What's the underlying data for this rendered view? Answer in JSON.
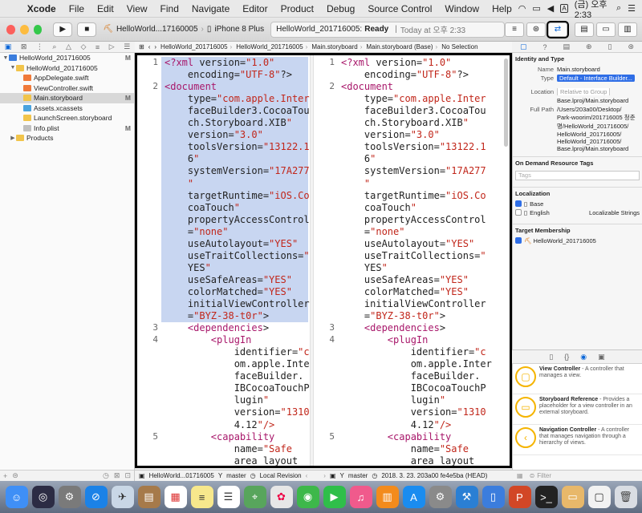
{
  "menubar": {
    "app": "Xcode",
    "items": [
      "File",
      "Edit",
      "View",
      "Find",
      "Navigate",
      "Editor",
      "Product",
      "Debug",
      "Source Control",
      "Window",
      "Help"
    ],
    "input_indicator": "A",
    "clock": "(금) 오후 2:33"
  },
  "toolbar": {
    "scheme_target": "HelloWorld...17160005",
    "device": "iPhone 8 Plus",
    "activity_project": "HelloWorld_201716005:",
    "activity_status": "Ready",
    "activity_time": "Today at 오후 2:33"
  },
  "navigator": {
    "items": [
      {
        "label": "HelloWorld_201716005",
        "indent": 0,
        "disc": "▼",
        "icon": "#3b7ddd",
        "status": "M"
      },
      {
        "label": "HelloWorld_201716005",
        "indent": 1,
        "disc": "▼",
        "icon": "#f1c44b",
        "status": ""
      },
      {
        "label": "AppDelegate.swift",
        "indent": 2,
        "disc": "",
        "icon": "#f07a3a",
        "status": ""
      },
      {
        "label": "ViewController.swift",
        "indent": 2,
        "disc": "",
        "icon": "#f07a3a",
        "status": ""
      },
      {
        "label": "Main.storyboard",
        "indent": 2,
        "disc": "",
        "icon": "#f1c44b",
        "status": "M",
        "selected": true
      },
      {
        "label": "Assets.xcassets",
        "indent": 2,
        "disc": "",
        "icon": "#4aa3df",
        "status": ""
      },
      {
        "label": "LaunchScreen.storyboard",
        "indent": 2,
        "disc": "",
        "icon": "#f1c44b",
        "status": ""
      },
      {
        "label": "Info.plist",
        "indent": 2,
        "disc": "",
        "icon": "#bfbfbf",
        "status": "M"
      },
      {
        "label": "Products",
        "indent": 1,
        "disc": "▶",
        "icon": "#f1c44b",
        "status": ""
      }
    ]
  },
  "jumpbar": {
    "crumbs": [
      "HelloWorld_201716005",
      "HelloWorld_201716005",
      "Main.storyboard",
      "Main.storyboard (Base)",
      "No Selection"
    ]
  },
  "editor": {
    "left_lines": [
      {
        "num": "1",
        "text": "<?xml version=\"1.0\"",
        "hl": true
      },
      {
        "num": "",
        "text": "    encoding=\"UTF-8\"?>",
        "hl": true
      },
      {
        "num": "2",
        "text": "<document",
        "hl": true
      },
      {
        "num": "",
        "text": "    type=\"com.apple.Inter",
        "hl": true
      },
      {
        "num": "",
        "text": "    faceBuilder3.CocoaTouc",
        "hl": true
      },
      {
        "num": "",
        "text": "    ch.Storyboard.XIB\"",
        "hl": true
      },
      {
        "num": "",
        "text": "    version=\"3.0\"",
        "hl": true
      },
      {
        "num": "",
        "text": "    toolsVersion=\"13122.1",
        "hl": true
      },
      {
        "num": "",
        "text": "    6\"",
        "hl": true
      },
      {
        "num": "",
        "text": "    systemVersion=\"17A277",
        "hl": true
      },
      {
        "num": "",
        "text": "    \"",
        "hl": true
      },
      {
        "num": "",
        "text": "    targetRuntime=\"iOS.Co",
        "hl": true
      },
      {
        "num": "",
        "text": "    coaTouch\"",
        "hl": true
      },
      {
        "num": "",
        "text": "    propertyAccessControl",
        "hl": true
      },
      {
        "num": "",
        "text": "    =\"none\"",
        "hl": true
      },
      {
        "num": "",
        "text": "    useAutolayout=\"YES\"",
        "hl": true
      },
      {
        "num": "",
        "text": "    useTraitCollections=\"",
        "hl": true
      },
      {
        "num": "",
        "text": "    YES\"",
        "hl": true
      },
      {
        "num": "",
        "text": "    useSafeAreas=\"YES\"",
        "hl": true
      },
      {
        "num": "",
        "text": "    colorMatched=\"YES\"",
        "hl": true
      },
      {
        "num": "",
        "text": "    initialViewController",
        "hl": true
      },
      {
        "num": "",
        "text": "    =\"BYZ-38-t0r\">",
        "hl": true
      },
      {
        "num": "3",
        "text": "    <dependencies>",
        "hl": false
      },
      {
        "num": "4",
        "text": "        <plugIn",
        "hl": false
      },
      {
        "num": "",
        "text": "            identifier=\"c",
        "hl": false
      },
      {
        "num": "",
        "text": "            om.apple.Inter",
        "hl": false
      },
      {
        "num": "",
        "text": "            faceBuilder.",
        "hl": false
      },
      {
        "num": "",
        "text": "            IBCocoaTouchP",
        "hl": false
      },
      {
        "num": "",
        "text": "            lugin\"",
        "hl": false
      },
      {
        "num": "",
        "text": "            version=\"1310",
        "hl": false
      },
      {
        "num": "",
        "text": "            4.12\"/>",
        "hl": false
      },
      {
        "num": "5",
        "text": "        <capability",
        "hl": false
      },
      {
        "num": "",
        "text": "            name=\"Safe",
        "hl": false
      },
      {
        "num": "",
        "text": "            area layout",
        "hl": false
      }
    ],
    "right_lines": [
      {
        "num": "1",
        "text": "<?xml version=\"1.0\""
      },
      {
        "num": "",
        "text": "    encoding=\"UTF-8\"?>"
      },
      {
        "num": "2",
        "text": "<document"
      },
      {
        "num": "",
        "text": "    type=\"com.apple.Inter"
      },
      {
        "num": "",
        "text": "    faceBuilder3.CocoaTou"
      },
      {
        "num": "",
        "text": "    ch.Storyboard.XIB\""
      },
      {
        "num": "",
        "text": "    version=\"3.0\""
      },
      {
        "num": "",
        "text": "    toolsVersion=\"13122.1"
      },
      {
        "num": "",
        "text": "    6\""
      },
      {
        "num": "",
        "text": "    systemVersion=\"17A277"
      },
      {
        "num": "",
        "text": "    \""
      },
      {
        "num": "",
        "text": "    targetRuntime=\"iOS.Co"
      },
      {
        "num": "",
        "text": "    coaTouch\""
      },
      {
        "num": "",
        "text": "    propertyAccessControl"
      },
      {
        "num": "",
        "text": "    =\"none\""
      },
      {
        "num": "",
        "text": "    useAutolayout=\"YES\""
      },
      {
        "num": "",
        "text": "    useTraitCollections=\""
      },
      {
        "num": "",
        "text": "    YES\""
      },
      {
        "num": "",
        "text": "    useSafeAreas=\"YES\""
      },
      {
        "num": "",
        "text": "    colorMatched=\"YES\""
      },
      {
        "num": "",
        "text": "    initialViewController"
      },
      {
        "num": "",
        "text": "    =\"BYZ-38-t0r\">"
      },
      {
        "num": "3",
        "text": "    <dependencies>"
      },
      {
        "num": "4",
        "text": "        <plugIn"
      },
      {
        "num": "",
        "text": "            identifier=\"c"
      },
      {
        "num": "",
        "text": "            om.apple.Inter"
      },
      {
        "num": "",
        "text": "            faceBuilder."
      },
      {
        "num": "",
        "text": "            IBCocoaTouchP"
      },
      {
        "num": "",
        "text": "            lugin\""
      },
      {
        "num": "",
        "text": "            version=\"1310"
      },
      {
        "num": "",
        "text": "            4.12\"/>"
      },
      {
        "num": "5",
        "text": "        <capability"
      },
      {
        "num": "",
        "text": "            name=\"Safe"
      },
      {
        "num": "",
        "text": "            area layout"
      }
    ]
  },
  "editor_footer": {
    "left_target": "HelloWorld...01716005",
    "left_branch": "master",
    "left_revision": "Local Revision",
    "right_branch": "master",
    "right_revision": "2018. 3. 23. 203a00 fe4e5ba (HEAD)"
  },
  "inspector": {
    "identity_title": "Identity and Type",
    "name_label": "Name",
    "name_value": "Main.storyboard",
    "type_label": "Type",
    "type_value": "Default - Interface Builder...",
    "location_label": "Location",
    "location_value": "Relative to Group",
    "location_path": "Base.lproj/Main.storyboard",
    "fullpath_label": "Full Path",
    "fullpath_lines": [
      "/Users/203a00/Desktop/",
      "Park-woorim/201716005 청춘",
      "명/HelloWorld_201716005/",
      "HelloWorld_201716005/",
      "HelloWorld_201716005/",
      "Base.lproj/Main.storyboard"
    ],
    "odr_title": "On Demand Resource Tags",
    "tags_placeholder": "Tags",
    "localization_title": "Localization",
    "loc_base": "Base",
    "loc_english": "English",
    "loc_english_value": "Localizable Strings",
    "target_title": "Target Membership",
    "target_name": "HelloWorld_201716005"
  },
  "library": {
    "items": [
      {
        "title": "View Controller",
        "desc": " - A controller that manages a view."
      },
      {
        "title": "Storyboard Reference",
        "desc": " - Provides a placeholder for a view controller in an external storyboard."
      },
      {
        "title": "Navigation Controller",
        "desc": " - A controller that manages navigation through a hierarchy of views."
      }
    ],
    "filter_placeholder": "Filter"
  },
  "colors": {
    "selection_blue": "#c8d6f1",
    "accent": "#2f6ee6"
  }
}
